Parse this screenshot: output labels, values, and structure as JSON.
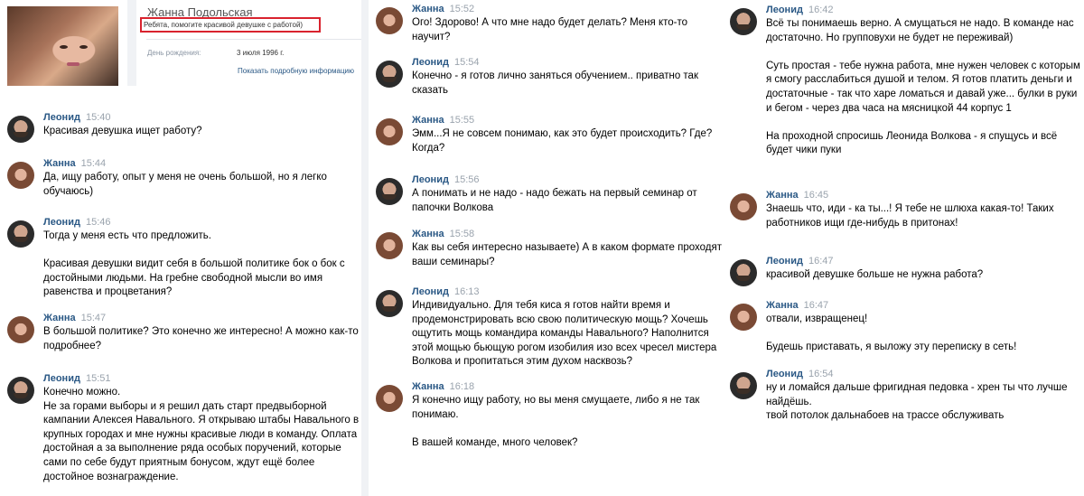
{
  "profile": {
    "name": "Жанна Подольская",
    "status": "Ребята, помогите красивой девушке с работой)",
    "birthday_label": "День рождения:",
    "birthday_value": "3 июля 1996 г.",
    "more_info": "Показать подробную информацию"
  },
  "columns": [
    [
      {
        "author": "Леонид",
        "time": "15:40",
        "avatar": "leonid",
        "text": "Красивая девушка ищет работу?"
      },
      {
        "author": "Жанна",
        "time": "15:44",
        "avatar": "zhanna",
        "text": "Да, ищу работу, опыт у меня не очень большой, но я легко обучаюсь)"
      },
      {
        "author": "Леонид",
        "time": "15:46",
        "avatar": "leonid",
        "text": "Тогда у меня есть что предложить.\n\nКрасивая девушки видит себя в большой политике бок о бок с достойными людьми. На гребне свободной мысли во имя равенства и процветания?"
      },
      {
        "author": "Жанна",
        "time": "15:47",
        "avatar": "zhanna",
        "text": "В большой политике? Это конечно же интересно! А можно как-то подробнее?"
      },
      {
        "author": "Леонид",
        "time": "15:51",
        "avatar": "leonid",
        "text": "Конечно можно.\nНе за горами выборы и я решил дать старт предвыборной кампании Алексея Навального. Я открываю штабы Навального в крупных городах и мне нужны красивые люди в команду. Оплата достойная а за выполнение ряда особых поручений, которые сами по себе будут приятным бонусом, ждут ещё более достойное вознаграждение."
      }
    ],
    [
      {
        "author": "Жанна",
        "time": "15:52",
        "avatar": "zhanna",
        "text": "Ого! Здорово! А что мне надо будет делать? Меня кто-то научит?"
      },
      {
        "author": "Леонид",
        "time": "15:54",
        "avatar": "leonid",
        "text": "Конечно - я готов лично заняться обучением.. приватно так сказать"
      },
      {
        "author": "Жанна",
        "time": "15:55",
        "avatar": "zhanna",
        "text": "Эмм...Я не совсем понимаю, как это будет происходить? Где? Когда?"
      },
      {
        "author": "Леонид",
        "time": "15:56",
        "avatar": "leonid",
        "text": "А понимать и не надо - надо бежать на первый семинар от папочки Волкова"
      },
      {
        "author": "Жанна",
        "time": "15:58",
        "avatar": "zhanna",
        "text": "Как вы себя интересно называете) А в каком формате проходят ваши семинары?"
      },
      {
        "author": "Леонид",
        "time": "16:13",
        "avatar": "leonid",
        "text": "Индивидуально. Для тебя киса я готов найти время и продемонстрировать всю свою политическую мощь? Хочешь ощутить мощь командира команды Навального? Наполнится этой мощью бьющую рогом изобилия изо всех чресел мистера Волкова и пропитаться этим духом насквозь?"
      },
      {
        "author": "Жанна",
        "time": "16:18",
        "avatar": "zhanna",
        "text": "Я конечно ищу работу, но вы меня смущаете, либо я не так понимаю.\n\nВ вашей команде, много человек?"
      }
    ],
    [
      {
        "author": "Леонид",
        "time": "16:42",
        "avatar": "leonid",
        "text": "Всё ты понимаешь верно. А смущаться не надо. В команде нас достаточно. Но групповухи не будет не переживай)\n\nСуть простая - тебе нужна работа, мне нужен человек с которым я смогу расслабиться душой и телом. Я готов платить деньги и достаточные - так что харе ломаться и давай уже... булки в руки и бегом - через два часа на мясницкой 44 корпус 1\n\nНа проходной спросишь Леонида Волкова - я спущусь и всё будет чики пуки"
      },
      {
        "author": "Жанна",
        "time": "16:45",
        "avatar": "zhanna",
        "text": "Знаешь что, иди - ка ты...! Я тебе не шлюха какая-то! Таких работников ищи где-нибудь в притонах!"
      },
      {
        "author": "Леонид",
        "time": "16:47",
        "avatar": "leonid",
        "text": "красивой девушке больше не нужна работа?"
      },
      {
        "author": "Жанна",
        "time": "16:47",
        "avatar": "zhanna",
        "text": "отвали, извращенец!\n\nБудешь приставать, я выложу эту переписку в сеть!"
      },
      {
        "author": "Леонид",
        "time": "16:54",
        "avatar": "leonid",
        "text": "ну и ломайся дальше фригидная педовка - хрен ты что лучше найдёшь.\nтвой потолок дальнабоев на трассе обслуживать"
      }
    ]
  ]
}
